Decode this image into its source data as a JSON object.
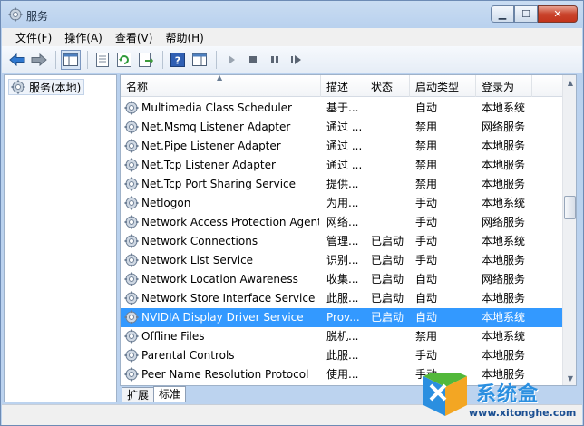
{
  "window": {
    "title": "服务"
  },
  "menu": [
    {
      "label": "文件(F)"
    },
    {
      "label": "操作(A)"
    },
    {
      "label": "查看(V)"
    },
    {
      "label": "帮助(H)"
    }
  ],
  "toolbar": {
    "buttons": [
      "back-icon",
      "forward-icon",
      "show-tree-icon",
      "properties-icon",
      "refresh-icon",
      "export-list-icon",
      "help-icon",
      "show-pane-icon",
      "start-service-icon",
      "stop-service-icon",
      "pause-service-icon",
      "restart-service-icon"
    ]
  },
  "tree": {
    "root_label": "服务(本地)"
  },
  "columns": {
    "name": "名称",
    "description": "描述",
    "status": "状态",
    "startup": "启动类型",
    "logon": "登录为"
  },
  "services": [
    {
      "name": "Multimedia Class Scheduler",
      "description": "基于...",
      "status": "",
      "startup": "自动",
      "logon": "本地系统"
    },
    {
      "name": "Net.Msmq Listener Adapter",
      "description": "通过 ...",
      "status": "",
      "startup": "禁用",
      "logon": "网络服务"
    },
    {
      "name": "Net.Pipe Listener Adapter",
      "description": "通过 ...",
      "status": "",
      "startup": "禁用",
      "logon": "本地服务"
    },
    {
      "name": "Net.Tcp Listener Adapter",
      "description": "通过 ...",
      "status": "",
      "startup": "禁用",
      "logon": "本地服务"
    },
    {
      "name": "Net.Tcp Port Sharing Service",
      "description": "提供...",
      "status": "",
      "startup": "禁用",
      "logon": "本地服务"
    },
    {
      "name": "Netlogon",
      "description": "为用...",
      "status": "",
      "startup": "手动",
      "logon": "本地系统"
    },
    {
      "name": "Network Access Protection Agent",
      "description": "网络...",
      "status": "",
      "startup": "手动",
      "logon": "网络服务"
    },
    {
      "name": "Network Connections",
      "description": "管理...",
      "status": "已启动",
      "startup": "手动",
      "logon": "本地系统"
    },
    {
      "name": "Network List Service",
      "description": "识别...",
      "status": "已启动",
      "startup": "手动",
      "logon": "本地服务"
    },
    {
      "name": "Network Location Awareness",
      "description": "收集...",
      "status": "已启动",
      "startup": "自动",
      "logon": "网络服务"
    },
    {
      "name": "Network Store Interface Service",
      "description": "此服...",
      "status": "已启动",
      "startup": "自动",
      "logon": "本地服务"
    },
    {
      "name": "NVIDIA Display Driver Service",
      "description": "Prov...",
      "status": "已启动",
      "startup": "自动",
      "logon": "本地系统"
    },
    {
      "name": "Offline Files",
      "description": "脱机...",
      "status": "",
      "startup": "禁用",
      "logon": "本地系统"
    },
    {
      "name": "Parental Controls",
      "description": "此服...",
      "status": "",
      "startup": "手动",
      "logon": "本地服务"
    },
    {
      "name": "Peer Name Resolution Protocol",
      "description": "使用...",
      "status": "",
      "startup": "手动",
      "logon": "本地服务"
    }
  ],
  "selected_service": "NVIDIA Display Driver Service",
  "tabs": [
    {
      "label": "扩展"
    },
    {
      "label": "标准"
    }
  ],
  "active_tab": "标准",
  "watermark": {
    "brand": "系统盒",
    "url": "www.xitonghe.com"
  },
  "colors": {
    "selection": "#3399ff",
    "title_gradient": "#c9dcf2"
  }
}
